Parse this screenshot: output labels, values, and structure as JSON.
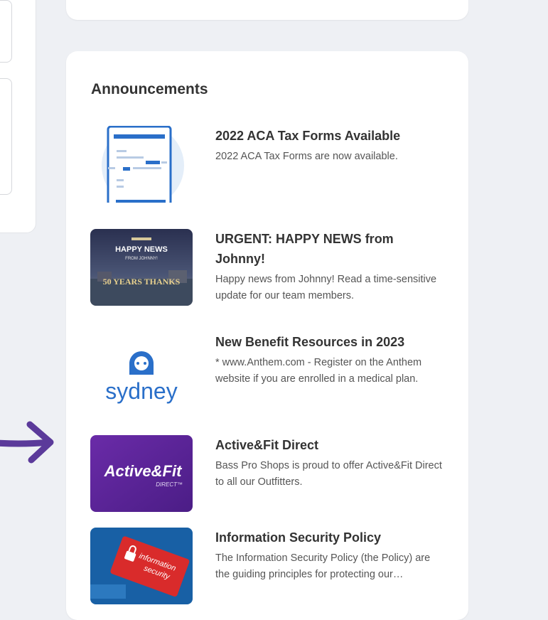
{
  "announcements": {
    "title": "Announcements",
    "items": [
      {
        "title": "2022 ACA Tax Forms Available",
        "description": "2022 ACA Tax Forms are now available.",
        "icon": "document-icon"
      },
      {
        "title": "URGENT: HAPPY NEWS from Johnny!",
        "description": "Happy news from Johnny! Read a time-sensitive update for our team members.",
        "thumb_text": [
          "HAPPY NEWS",
          "FROM JOHNNY!",
          "50 YEARS THANKS"
        ]
      },
      {
        "title": "New Benefit Resources in 2023",
        "description": "* www.Anthem.com - Register on the Anthem website if you are enrolled in a medical plan.",
        "thumb_text": "sydney"
      },
      {
        "title": "Active&Fit Direct",
        "description": "Bass Pro Shops is proud to offer Active&Fit Direct to all our Outfitters.",
        "thumb_text": [
          "Active&Fit",
          "DIRECT™"
        ]
      },
      {
        "title": "Information Security Policy",
        "description": "The Information Security Policy (the Policy) are the guiding principles for protecting our information.",
        "thumb_text": [
          "information",
          "security"
        ]
      }
    ]
  },
  "annotation": {
    "icon": "arrow-icon",
    "color": "#5b3a9a"
  },
  "colors": {
    "accent": "#2a6fc9",
    "card": "#ffffff",
    "background": "#eef0f4"
  }
}
